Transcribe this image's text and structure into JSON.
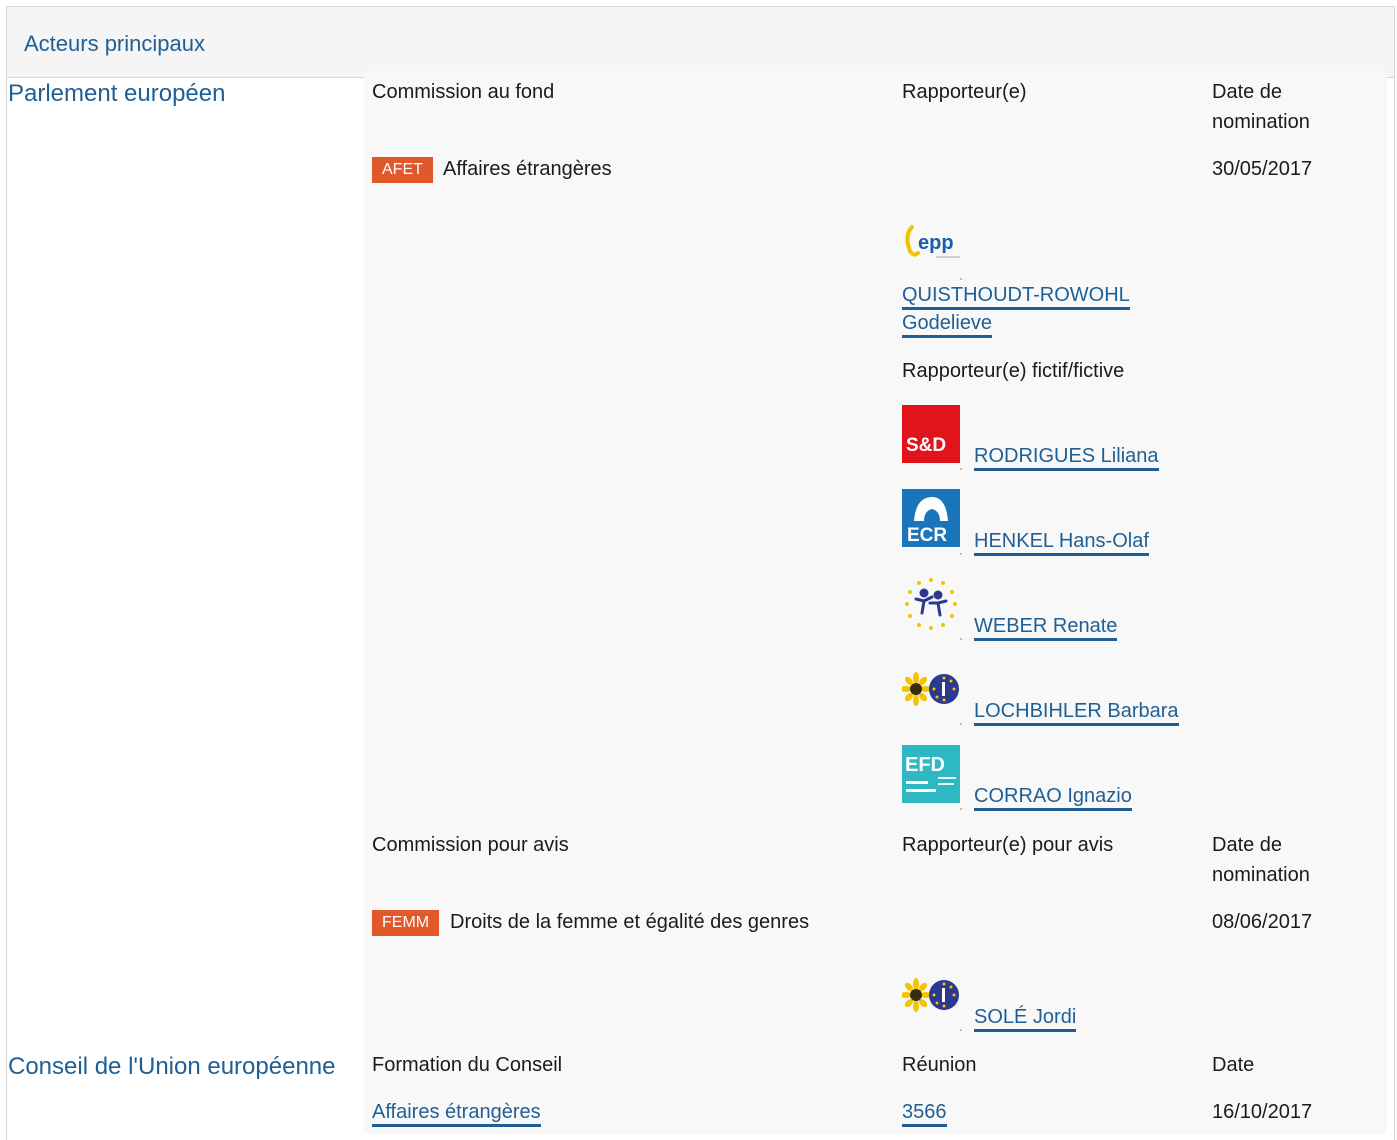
{
  "header": {
    "title": "Acteurs principaux"
  },
  "parliament": {
    "label": "Parlement européen",
    "lead": {
      "col_committee": "Commission au fond",
      "col_rapporteur": "Rapporteur(e)",
      "col_date": "Date de nomination",
      "committee_code": "AFET",
      "committee_name": "Affaires étrangères",
      "date": "30/05/2017",
      "rapporteur": {
        "name": "QUISTHOUDT-ROWOHL Godelieve",
        "group_logo_text": "epp"
      },
      "shadow_label": "Rapporteur(e) fictif/fictive",
      "shadows": [
        {
          "name": "RODRIGUES Liliana",
          "group_logo_text": "S&D"
        },
        {
          "name": "HENKEL Hans-Olaf",
          "group_logo_text": "ECR"
        },
        {
          "name": "WEBER Renate",
          "group_logo_text": ""
        },
        {
          "name": "LOCHBIHLER Barbara",
          "group_logo_text": ""
        },
        {
          "name": "CORRAO Ignazio",
          "group_logo_text": "EFD"
        }
      ]
    },
    "opinion": {
      "col_committee": "Commission pour avis",
      "col_rapporteur": "Rapporteur(e) pour avis",
      "col_date": "Date de nomination",
      "committee_code": "FEMM",
      "committee_name": "Droits de la femme et égalité des genres",
      "date": "08/06/2017",
      "rapporteur": {
        "name": "SOLÉ Jordi"
      }
    }
  },
  "council": {
    "label": "Conseil de l'Union européenne",
    "col_formation": "Formation du Conseil",
    "col_meeting": "Réunion",
    "col_date": "Date",
    "formation": "Affaires étrangères",
    "meeting": "3566",
    "date": "16/10/2017"
  },
  "colors": {
    "link": "#1f5f95",
    "badge": "#e1582a",
    "sd": "#e2141b",
    "ecr": "#1a75bb",
    "efd": "#2db8c4",
    "greens_yellow": "#f5c400",
    "eu_blue": "#2b3a8f"
  }
}
